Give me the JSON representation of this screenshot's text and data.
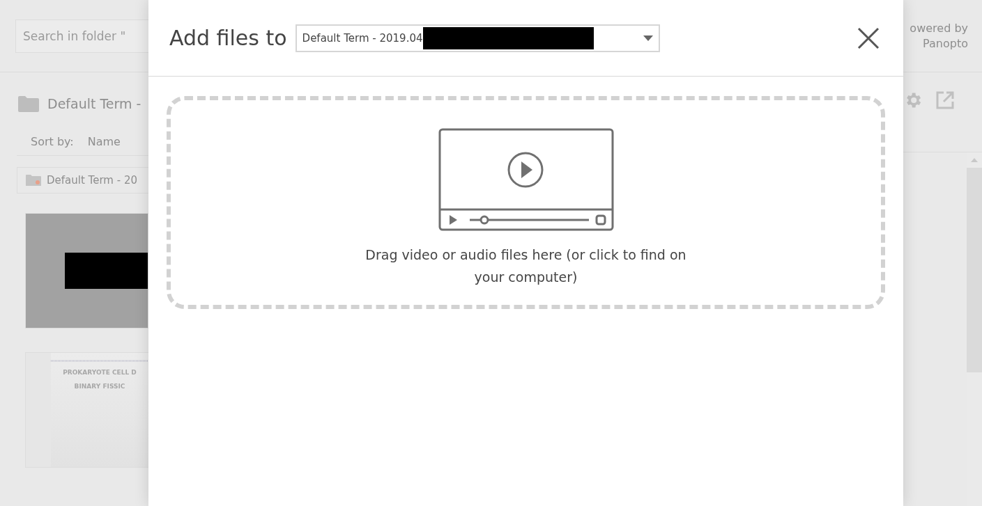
{
  "background": {
    "search": {
      "placeholder": "Search in folder \""
    },
    "folder_title": "Default Term -",
    "sort": {
      "label": "Sort by:",
      "options": [
        "Name"
      ]
    },
    "breadcrumb": "Default Term - 20",
    "sessions": [
      {
        "kind": "redacted"
      },
      {
        "kind": "slide",
        "lines": [
          "PROKARYOTE CELL D",
          "BINARY FISSIC"
        ]
      }
    ],
    "powered_by": [
      "owered by",
      "Panopto"
    ]
  },
  "modal": {
    "title": "Add files to",
    "folder_select": {
      "value": "Default Term - 2019.04",
      "redacted": true
    },
    "dropzone": {
      "text": "Drag video or audio files here (or click to find on your computer)"
    }
  }
}
